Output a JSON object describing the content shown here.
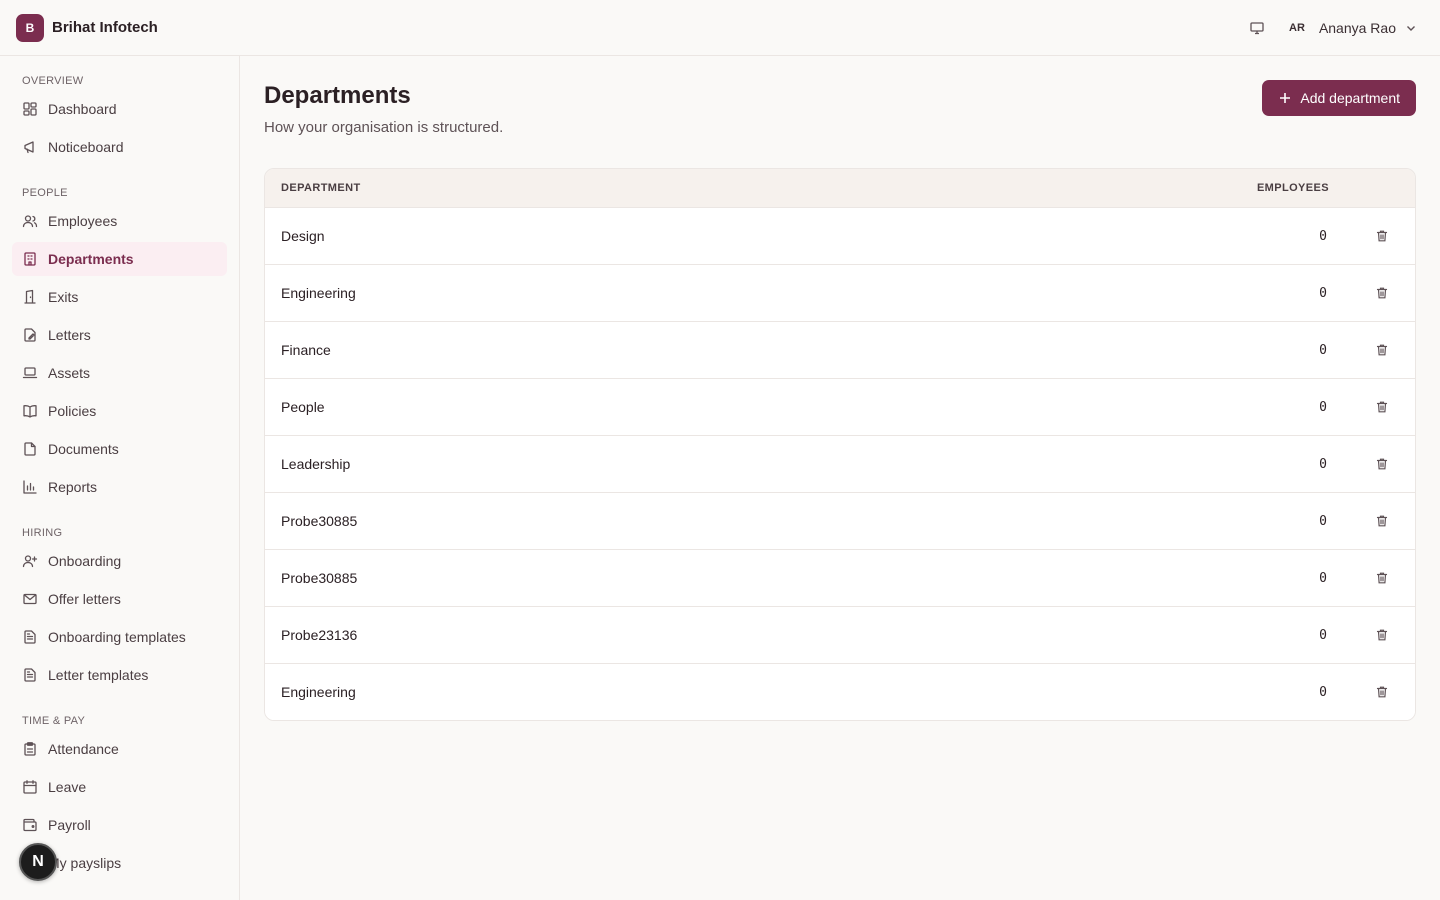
{
  "brand": {
    "logo_letter": "B",
    "name": "Brihat Infotech"
  },
  "user": {
    "initials": "AR",
    "name": "Ananya Rao"
  },
  "sidebar": {
    "sections": [
      {
        "label": "OVERVIEW",
        "items": [
          {
            "label": "Dashboard",
            "icon": "dashboard-icon"
          },
          {
            "label": "Noticeboard",
            "icon": "megaphone-icon"
          }
        ]
      },
      {
        "label": "PEOPLE",
        "items": [
          {
            "label": "Employees",
            "icon": "users-icon"
          },
          {
            "label": "Departments",
            "icon": "building-icon",
            "active": true
          },
          {
            "label": "Exits",
            "icon": "door-icon"
          },
          {
            "label": "Letters",
            "icon": "file-edit-icon"
          },
          {
            "label": "Assets",
            "icon": "laptop-icon"
          },
          {
            "label": "Policies",
            "icon": "book-icon"
          },
          {
            "label": "Documents",
            "icon": "document-icon"
          },
          {
            "label": "Reports",
            "icon": "bar-chart-icon"
          }
        ]
      },
      {
        "label": "HIRING",
        "items": [
          {
            "label": "Onboarding",
            "icon": "user-plus-icon"
          },
          {
            "label": "Offer letters",
            "icon": "mail-icon"
          },
          {
            "label": "Onboarding templates",
            "icon": "file-text-icon"
          },
          {
            "label": "Letter templates",
            "icon": "file-text-icon"
          }
        ]
      },
      {
        "label": "TIME & PAY",
        "items": [
          {
            "label": "Attendance",
            "icon": "clipboard-icon"
          },
          {
            "label": "Leave",
            "icon": "calendar-icon"
          },
          {
            "label": "Payroll",
            "icon": "wallet-icon"
          },
          {
            "label": "My payslips",
            "icon": "receipt-icon"
          }
        ]
      }
    ]
  },
  "main": {
    "title": "Departments",
    "subtitle": "How your organisation is structured.",
    "add_button_label": "Add department",
    "table": {
      "columns": {
        "department": "DEPARTMENT",
        "employees": "EMPLOYEES"
      },
      "rows": [
        {
          "name": "Design",
          "employees": "0"
        },
        {
          "name": "Engineering",
          "employees": "0"
        },
        {
          "name": "Finance",
          "employees": "0"
        },
        {
          "name": "People",
          "employees": "0"
        },
        {
          "name": "Leadership",
          "employees": "0"
        },
        {
          "name": "Probe30885",
          "employees": "0"
        },
        {
          "name": "Probe30885",
          "employees": "0"
        },
        {
          "name": "Probe23136",
          "employees": "0"
        },
        {
          "name": "Engineering",
          "employees": "0"
        }
      ]
    }
  },
  "floating_badge": {
    "letter": "N"
  },
  "colors": {
    "accent": "#7b2d4f",
    "active_bg": "#fbeef2",
    "header_bg": "#f6f1ed"
  }
}
